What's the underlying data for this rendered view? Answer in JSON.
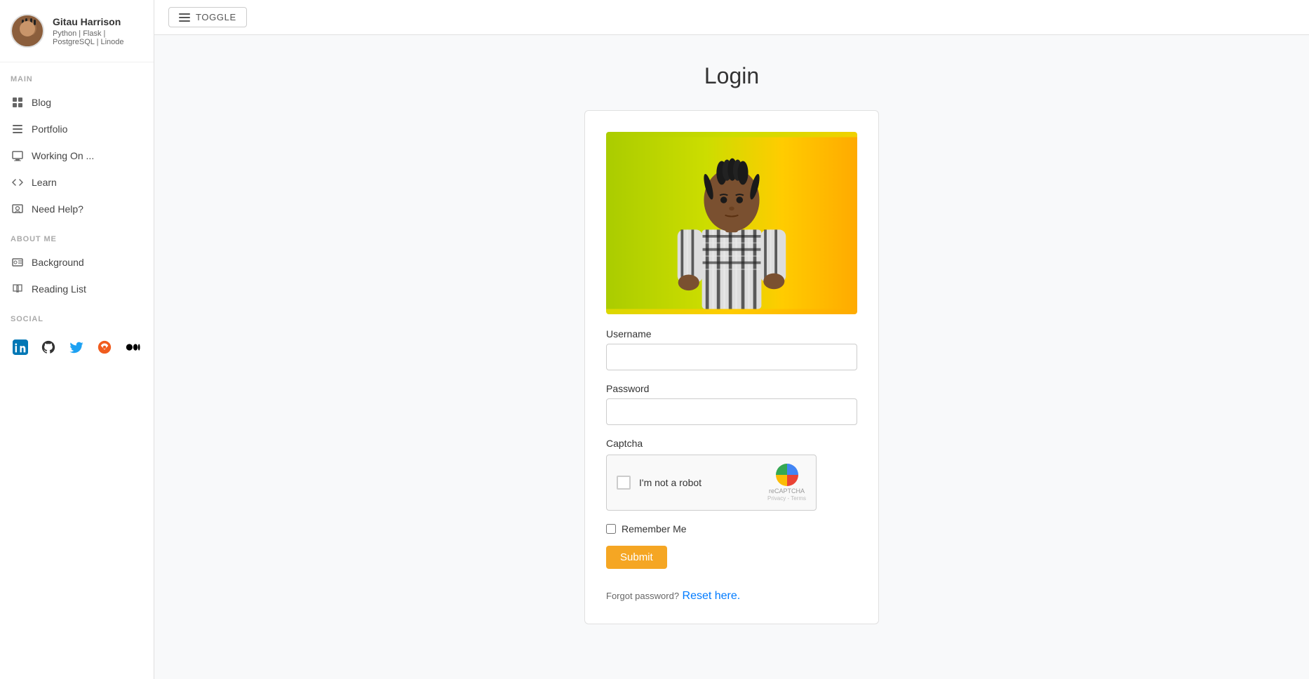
{
  "sidebar": {
    "profile": {
      "name": "Gitau Harrison",
      "tags": "Python | Flask | PostgreSQL | Linode"
    },
    "sections": {
      "main": {
        "label": "MAIN",
        "items": [
          {
            "id": "blog",
            "label": "Blog",
            "icon": "grid-icon"
          },
          {
            "id": "portfolio",
            "label": "Portfolio",
            "icon": "list-icon"
          },
          {
            "id": "working-on",
            "label": "Working On ...",
            "icon": "monitor-icon"
          },
          {
            "id": "learn",
            "label": "Learn",
            "icon": "code-icon"
          },
          {
            "id": "need-help",
            "label": "Need Help?",
            "icon": "help-icon"
          }
        ]
      },
      "about": {
        "label": "ABOUT ME",
        "items": [
          {
            "id": "background",
            "label": "Background",
            "icon": "id-card-icon"
          },
          {
            "id": "reading-list",
            "label": "Reading List",
            "icon": "book-icon"
          }
        ]
      },
      "social": {
        "label": "SOCIAL",
        "icons": [
          {
            "id": "linkedin",
            "label": "LinkedIn",
            "symbol": "in"
          },
          {
            "id": "github",
            "label": "GitHub",
            "symbol": "gh"
          },
          {
            "id": "twitter",
            "label": "Twitter",
            "symbol": "tw"
          },
          {
            "id": "hashnode",
            "label": "Hashnode",
            "symbol": "hn"
          },
          {
            "id": "medium",
            "label": "Medium",
            "symbol": "m"
          }
        ]
      }
    }
  },
  "topbar": {
    "toggle_label": "Toggle"
  },
  "login": {
    "title": "Login",
    "username_label": "Username",
    "username_placeholder": "",
    "password_label": "Password",
    "password_placeholder": "",
    "captcha_label": "Captcha",
    "captcha_text": "I'm not a robot",
    "recaptcha_label": "reCAPTCHA",
    "recaptcha_privacy": "Privacy - Terms",
    "remember_label": "Remember Me",
    "submit_label": "Submit",
    "forgot_text": "Forgot password?",
    "reset_text": "Reset here."
  }
}
